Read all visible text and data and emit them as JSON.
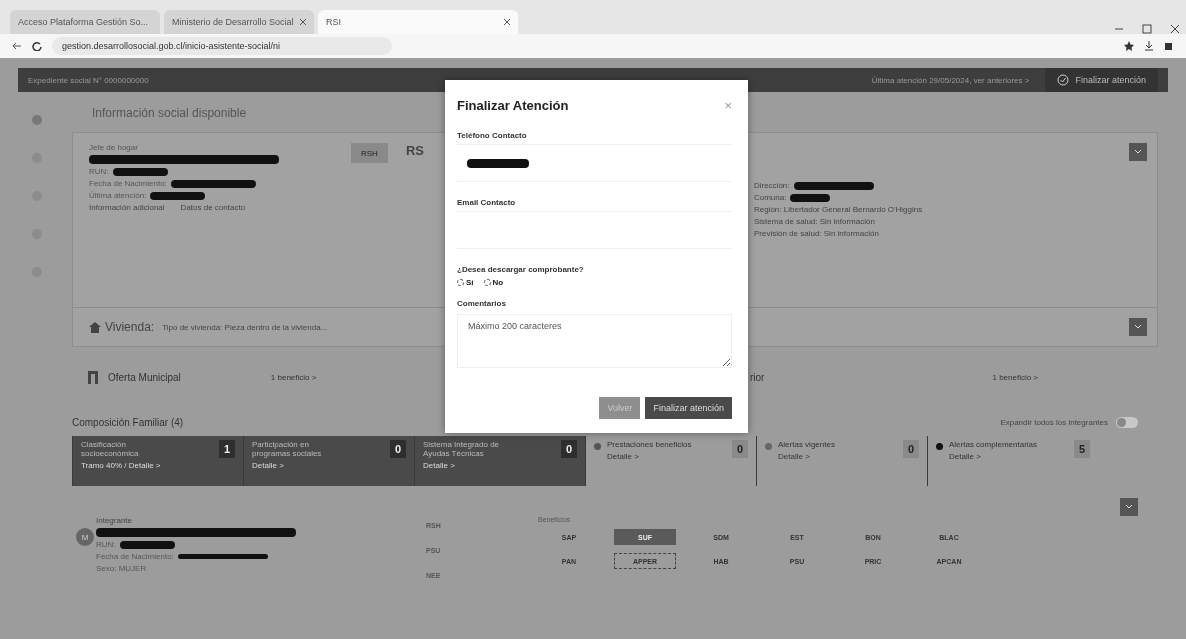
{
  "browser": {
    "tabs": [
      {
        "label": "Acceso Plataforma Gestión So...",
        "selected": false
      },
      {
        "label": "Ministerio de Desarrollo Social",
        "selected": false
      },
      {
        "label": "RSI",
        "selected": true
      }
    ],
    "url": "gestion.desarrollosocial.gob.cl/inicio-asistente-social/ni"
  },
  "top_bar": {
    "left": "Expediente social N° 0000000000",
    "last_visit": "Última atención 29/05/2024, ver anteriores >",
    "finish": "Finalizar atención"
  },
  "heading": "Información social disponible",
  "person": {
    "caption": "Jefe de hogar",
    "tag": "RSH",
    "labels": [
      "RUN:",
      "Fecha de Nacimiento:",
      "Última atención:"
    ],
    "links": [
      "Información adicional",
      "Datos de contacto"
    ]
  },
  "rsh": {
    "title": "RS",
    "lines": [
      "Dirección:",
      "Comuna:",
      "Región: Libertador General Bernardo O'Higgins",
      "Sistema de salud: Sin información",
      "Previsión de salud: Sin información"
    ]
  },
  "vivienda": {
    "label": "Vivienda:",
    "text": "Tipo de vivienda: Pieza dentro de la vivienda..."
  },
  "oferta": [
    {
      "label": "Oferta Municipal",
      "link": "1 beneficio >"
    },
    {
      "label": "rior",
      "link": "1 beneficio >"
    }
  ],
  "family": {
    "title": "Composición Familiar (4)",
    "expand_label": "Expandir todos los integrantes",
    "expand_on": false
  },
  "stats": [
    {
      "kind": "dark",
      "label": "Clasificación socioeconómica",
      "detail": "Tramo 40% / Detalle >",
      "count": "1"
    },
    {
      "kind": "dark",
      "label": "Participación en programas sociales",
      "detail": "Detalle >",
      "count": "0"
    },
    {
      "kind": "dark",
      "label": "Sistema Integrado de Ayudas Técnicas",
      "detail": "Detalle >",
      "count": "0"
    },
    {
      "kind": "light",
      "label": "Prestaciones beneficios",
      "detail": "Detalle >",
      "count": "0",
      "color": "#555555"
    },
    {
      "kind": "light",
      "label": "Alertas vigentes",
      "detail": "Detalle >",
      "count": "0",
      "color": "#666666"
    },
    {
      "kind": "light",
      "label": "Alertas complementarias",
      "detail": "Detalle >",
      "count": "5",
      "color": "#111111"
    }
  ],
  "member": {
    "caption": "Integrante",
    "initials": "M",
    "labels": [
      "RUN:",
      "Fecha de Nacimiento:",
      "Sexo: MUJER"
    ],
    "codes": [
      "RSH",
      "PSU",
      "NEE"
    ],
    "benefits_title": "Beneficios",
    "benefits": [
      {
        "label": "SAP",
        "selected": false,
        "focused": false
      },
      {
        "label": "SUF",
        "selected": true,
        "focused": false
      },
      {
        "label": "SDM",
        "selected": false,
        "focused": false
      },
      {
        "label": "EST",
        "selected": false,
        "focused": false
      },
      {
        "label": "BON",
        "selected": false,
        "focused": false
      },
      {
        "label": "BLAC",
        "selected": false,
        "focused": false
      },
      {
        "label": "PAN",
        "selected": false,
        "focused": false
      },
      {
        "label": "APPER",
        "selected": false,
        "focused": true
      },
      {
        "label": "HAB",
        "selected": false,
        "focused": false
      },
      {
        "label": "PSU",
        "selected": false,
        "focused": false
      },
      {
        "label": "PRIC",
        "selected": false,
        "focused": false
      },
      {
        "label": "APCAN",
        "selected": false,
        "focused": false
      }
    ]
  },
  "modal": {
    "title": "Finalizar Atención",
    "close": "×",
    "phone_label": "Teléfono Contacto",
    "email_label": "Email Contacto",
    "question": "¿Desea descargar comprobante?",
    "options": [
      {
        "label": "Sí",
        "selected": false
      },
      {
        "label": "No",
        "selected": false
      }
    ],
    "comments_label": "Comentarios",
    "comments_placeholder": "Máximo 200 caracteres",
    "buttons": [
      {
        "kind": "secondary",
        "label": "Volver"
      },
      {
        "kind": "primary",
        "label": "Finalizar atención"
      }
    ]
  }
}
